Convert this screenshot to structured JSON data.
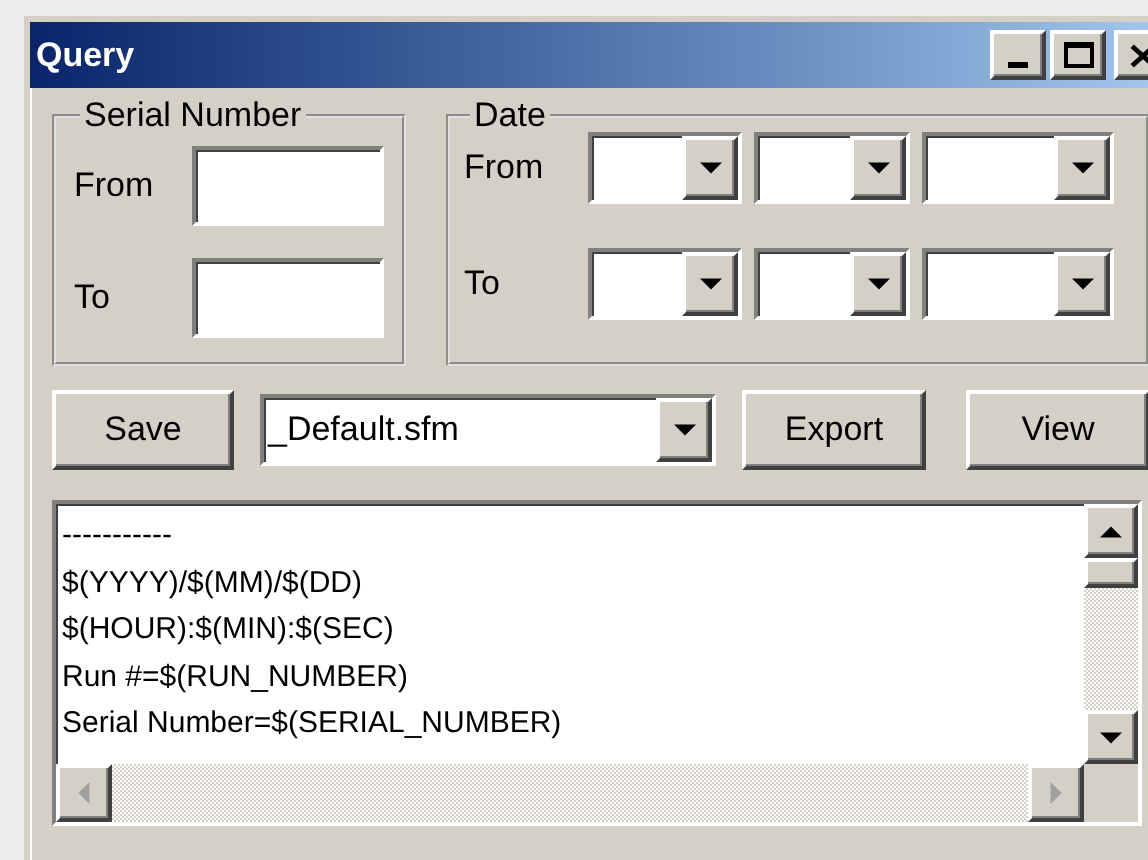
{
  "window": {
    "title": "Query"
  },
  "serial_number": {
    "label": "Serial Number",
    "rows": [
      {
        "label": "From"
      },
      {
        "label": "To"
      }
    ]
  },
  "date": {
    "label": "Date",
    "rows": [
      {
        "label": "From"
      },
      {
        "label": "To"
      }
    ]
  },
  "toolbar": {
    "save": "Save",
    "format": {
      "value": "_Default.sfm"
    },
    "export": "Export",
    "view": "View"
  },
  "template_text": {
    "lines": [
      "-----------",
      "$(YYYY)/$(MM)/$(DD)",
      "$(HOUR):$(MIN):$(SEC)",
      "Run #=$(RUN_NUMBER)",
      "Serial Number=$(SERIAL_NUMBER)"
    ]
  }
}
